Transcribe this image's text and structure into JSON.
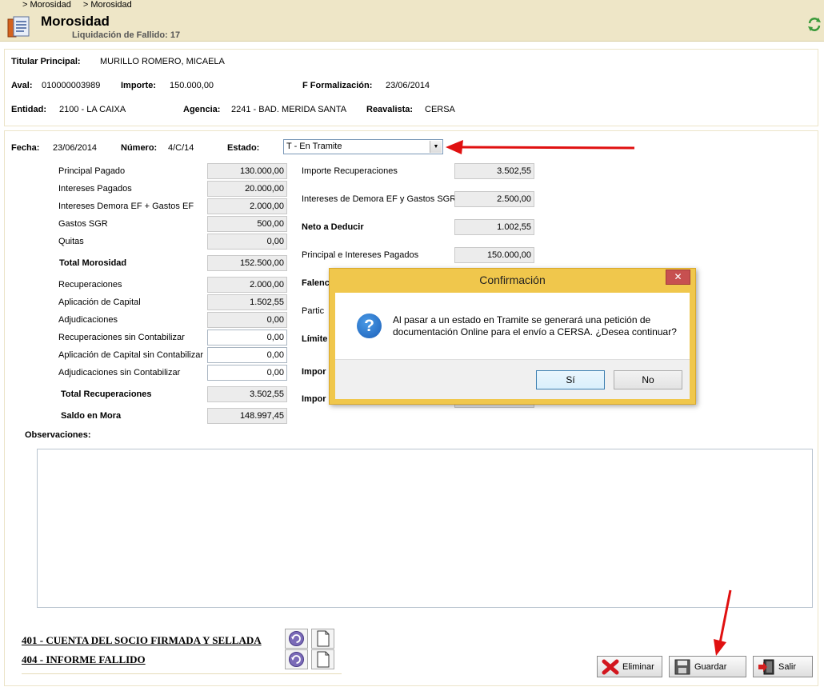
{
  "header": {
    "breadcrumbs": [
      "> Morosidad",
      "> Morosidad"
    ],
    "title": "Morosidad",
    "subtitle": "Liquidación de Fallido: 17"
  },
  "info": {
    "titular_label": "Titular Principal:",
    "titular_value": "MURILLO ROMERO, MICAELA",
    "aval_label": "Aval:",
    "aval_value": "010000003989",
    "importe_label": "Importe:",
    "importe_value": "150.000,00",
    "f_formalizacion_label": "F Formalización:",
    "f_formalizacion_value": "23/06/2014",
    "entidad_label": "Entidad:",
    "entidad_value": "2100 - LA CAIXA",
    "agencia_label": "Agencia:",
    "agencia_value": "2241 - BAD. MERIDA SANTA",
    "reavalista_label": "Reavalista:",
    "reavalista_value": "CERSA"
  },
  "form": {
    "fecha_label": "Fecha:",
    "fecha_value": "23/06/2014",
    "numero_label": "Número:",
    "numero_value": "4/C/14",
    "estado_label": "Estado:",
    "estado_value": "T - En Tramite"
  },
  "left_fields": [
    {
      "label": "Principal Pagado",
      "value": "130.000,00"
    },
    {
      "label": "Intereses Pagados",
      "value": "20.000,00"
    },
    {
      "label": "Intereses Demora EF + Gastos EF",
      "value": "2.000,00"
    },
    {
      "label": "Gastos SGR",
      "value": "500,00"
    },
    {
      "label": "Quitas",
      "value": "0,00"
    },
    {
      "label": "Total Morosidad",
      "value": "152.500,00"
    },
    {
      "label": "Recuperaciones",
      "value": "2.000,00"
    },
    {
      "label": "Aplicación de Capital",
      "value": "1.502,55"
    },
    {
      "label": "Adjudicaciones",
      "value": "0,00"
    },
    {
      "label": "Recuperaciones sin Contabilizar",
      "value": "0,00"
    },
    {
      "label": "Aplicación de Capital sin Contabilizar",
      "value": "0,00"
    },
    {
      "label": "Adjudicaciones sin Contabilizar",
      "value": "0,00"
    },
    {
      "label": "Total Recuperaciones",
      "value": "3.502,55"
    },
    {
      "label": "Saldo en Mora",
      "value": "148.997,45"
    }
  ],
  "right_fields": [
    {
      "label": "Importe Recuperaciones",
      "value": "3.502,55"
    },
    {
      "label": "Intereses de Demora EF y Gastos SGR",
      "value": "2.500,00"
    },
    {
      "label": "Neto a Deducir",
      "value": "1.002,55"
    },
    {
      "label": "Principal e Intereses Pagados",
      "value": "150.000,00"
    },
    {
      "label": "Falenc",
      "value": ""
    },
    {
      "label": "Partic",
      "value": ""
    },
    {
      "label": "Límite",
      "value": ""
    },
    {
      "label": "Impor",
      "value": ""
    },
    {
      "label": "Impor",
      "value": ""
    }
  ],
  "observaciones_label": "Observaciones:",
  "documents": [
    {
      "label": "401 - CUENTA DEL SOCIO FIRMADA Y SELLADA"
    },
    {
      "label": "404 - INFORME FALLIDO"
    }
  ],
  "buttons": {
    "eliminar": "Eliminar",
    "guardar": "Guardar",
    "salir": "Salir"
  },
  "dialog": {
    "title": "Confirmación",
    "close": "✕",
    "message": "Al pasar a un estado en Tramite se generará una petición de documentación Online para el envío a CERSA. ¿Desea continuar?",
    "yes": "Sí",
    "no": "No"
  },
  "colors": {
    "header_bg": "#eee6c7",
    "dialog_frame": "#f0c74c",
    "annotation_arrow": "#e01010"
  }
}
